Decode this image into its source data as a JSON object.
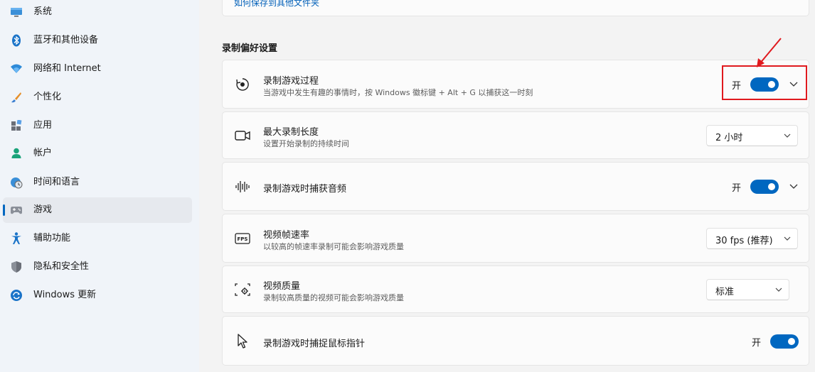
{
  "sidebar": {
    "items": [
      {
        "label": "系统",
        "icon": "monitor-icon"
      },
      {
        "label": "蓝牙和其他设备",
        "icon": "bluetooth-icon"
      },
      {
        "label": "网络和 Internet",
        "icon": "wifi-icon"
      },
      {
        "label": "个性化",
        "icon": "brush-icon"
      },
      {
        "label": "应用",
        "icon": "apps-icon"
      },
      {
        "label": "帐户",
        "icon": "person-icon"
      },
      {
        "label": "时间和语言",
        "icon": "globe-clock-icon"
      },
      {
        "label": "游戏",
        "icon": "gamepad-icon",
        "active": true
      },
      {
        "label": "辅助功能",
        "icon": "accessibility-icon"
      },
      {
        "label": "隐私和安全性",
        "icon": "shield-icon"
      },
      {
        "label": "Windows 更新",
        "icon": "update-icon"
      }
    ]
  },
  "top_card": {
    "link": "如何保存到其他文件夹"
  },
  "section": {
    "title": "录制偏好设置"
  },
  "settings": {
    "record_game": {
      "title": "录制游戏过程",
      "subtitle": "当游戏中发生有趣的事情时，按 Windows 徽标键 + Alt + G 以捕获这一时刻",
      "toggle_label": "开",
      "toggle_on": true,
      "icon": "record-icon"
    },
    "max_length": {
      "title": "最大录制长度",
      "subtitle": "设置开始录制的持续时间",
      "value": "2 小时",
      "icon": "video-camera-icon"
    },
    "capture_audio": {
      "title": "录制游戏时捕获音频",
      "toggle_label": "开",
      "toggle_on": true,
      "icon": "audio-wave-icon"
    },
    "frame_rate": {
      "title": "视频帧速率",
      "subtitle": "以较高的帧速率录制可能会影响游戏质量",
      "value": "30 fps (推荐)",
      "icon": "fps-icon"
    },
    "video_quality": {
      "title": "视频质量",
      "subtitle": "录制较高质量的视频可能会影响游戏质量",
      "value": "标准",
      "icon": "quality-icon"
    },
    "capture_cursor": {
      "title": "录制游戏时捕捉鼠标指针",
      "toggle_label": "开",
      "toggle_on": true,
      "icon": "cursor-icon"
    }
  },
  "colors": {
    "accent": "#0067c0",
    "annotation": "#e0191e",
    "link": "#005fb8"
  }
}
